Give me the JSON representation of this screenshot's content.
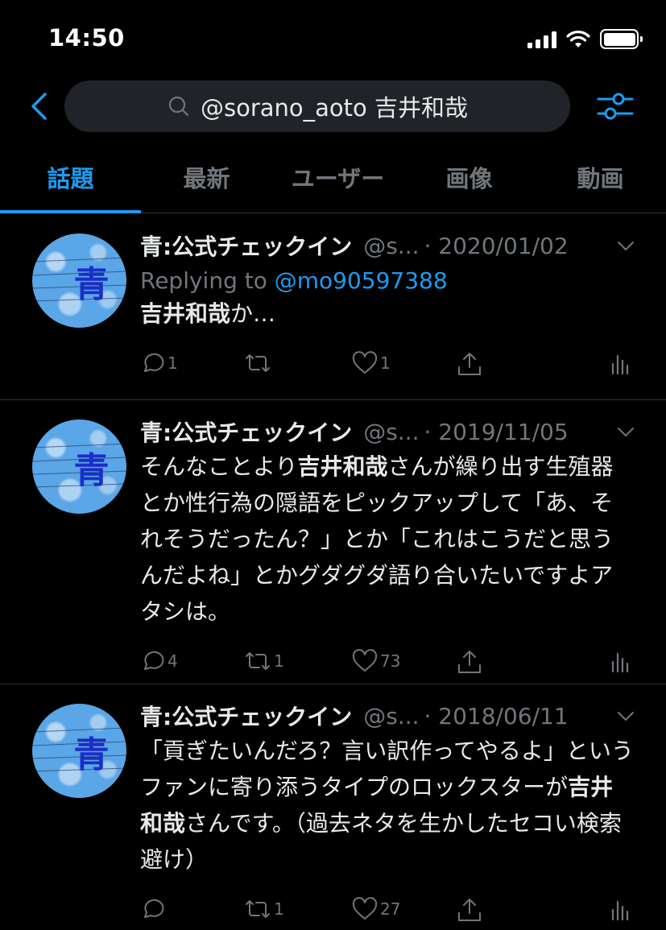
{
  "status_bar": {
    "time": "14:50"
  },
  "search": {
    "query": "@sorano_aoto  吉井和哉"
  },
  "tabs": [
    {
      "label": "話題",
      "active": true
    },
    {
      "label": "最新"
    },
    {
      "label": "ユーザー"
    },
    {
      "label": "画像"
    },
    {
      "label": "動画"
    }
  ],
  "tweets": [
    {
      "name": "青:公式チェックイン",
      "handle": "@s...",
      "date": "· 2020/01/02",
      "reply_prefix": "Replying to ",
      "reply_to": "@mo90597388",
      "body_highlight": "吉井和哉",
      "body_pre": "",
      "body_post": "か…",
      "avatar_char": "青",
      "replies": "1",
      "retweets": "",
      "likes": "1"
    },
    {
      "name": "青:公式チェックイン",
      "handle": "@s...",
      "date": "· 2019/11/05",
      "body_pre": "そんなことより",
      "body_highlight": "吉井和哉",
      "body_post": "さんが繰り出す生殖器とか性行為の隠語をピックアップして「あ、それそうだったん？」とか「これはこうだと思うんだよね」とかグダグダ語り合いたいですよアタシは。",
      "avatar_char": "青",
      "replies": "4",
      "retweets": "1",
      "likes": "73"
    },
    {
      "name": "青:公式チェックイン",
      "handle": "@s...",
      "date": "· 2018/06/11",
      "body_pre": "「貢ぎたいんだろ？言い訳作ってやるよ」というファンに寄り添うタイプのロックスターが",
      "body_highlight": "吉井和哉",
      "body_post": "さんです。（過去ネタを生かしたセコい検索避け）",
      "avatar_char": "青",
      "replies": "",
      "retweets": "1",
      "likes": "27"
    }
  ],
  "colors": {
    "accent": "#1d9bf0",
    "muted": "#71767b",
    "divider": "#2f3336",
    "search_bg": "#202327"
  }
}
